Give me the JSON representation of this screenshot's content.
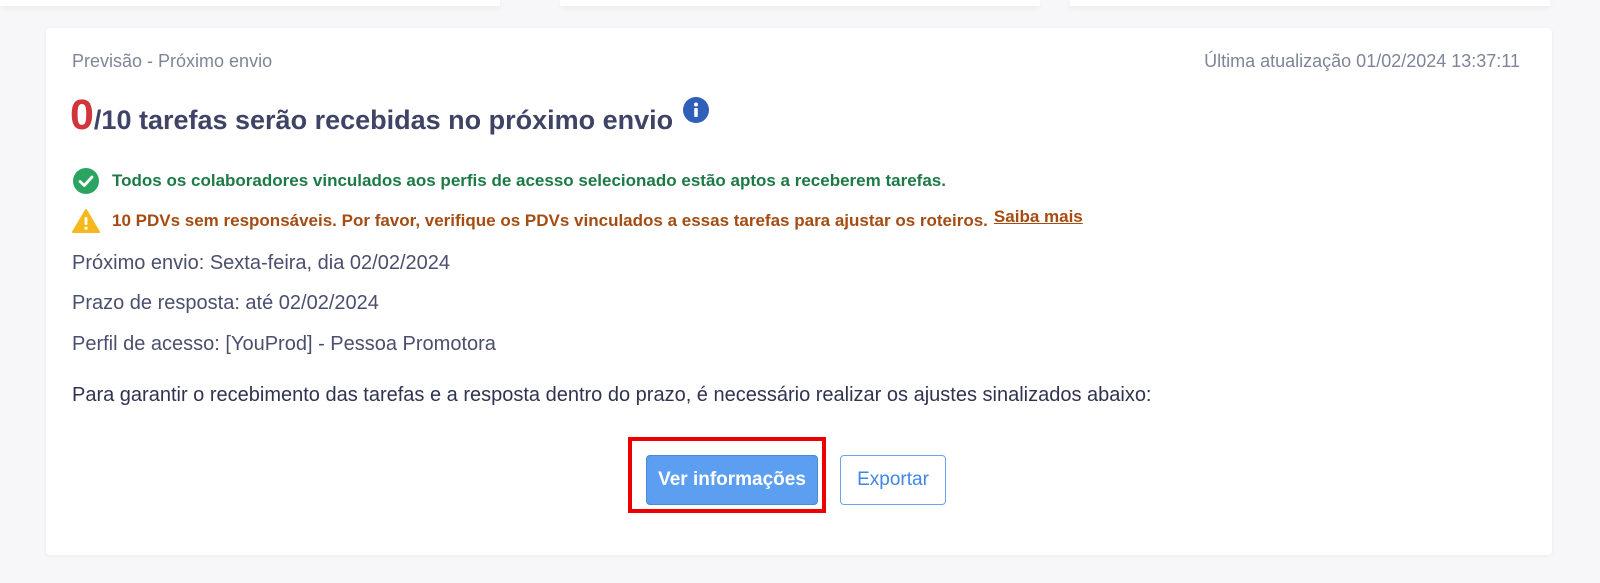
{
  "header": {
    "label": "Previsão - Próximo envio",
    "last_update": "Última atualização 01/02/2024 13:37:11"
  },
  "headline": {
    "count": "0",
    "text": "/10 tarefas serão recebidas no próximo envio"
  },
  "status": {
    "ok_text": "Todos os colaboradores vinculados aos perfis de acesso selecionado estão aptos a receberem tarefas.",
    "warn_text": "10 PDVs sem responsáveis. Por favor, verifique os PDVs vinculados a essas tarefas para ajustar os roteiros.",
    "warn_link": "Saiba mais"
  },
  "details": {
    "next_send": "Próximo envio: Sexta-feira, dia 02/02/2024",
    "deadline": "Prazo de resposta: até 02/02/2024",
    "profile": "Perfil de acesso: [YouProd] - Pessoa Promotora",
    "instruction": "Para garantir o recebimento das tarefas e a resposta dentro do prazo, é necessário realizar os ajustes sinalizados abaixo:"
  },
  "actions": {
    "primary_label": "Ver informações",
    "secondary_label": "Exportar"
  },
  "colors": {
    "count_red": "#d1363d",
    "ok_green": "#1c7a46",
    "warn_orange": "#a54c12",
    "warn_icon": "#f6b81a",
    "primary_blue": "#5c9ff0",
    "highlight_red": "#ee0000"
  },
  "icons": {
    "headline": "info-icon",
    "ok": "check-circle-icon",
    "warn": "warning-triangle-icon"
  }
}
